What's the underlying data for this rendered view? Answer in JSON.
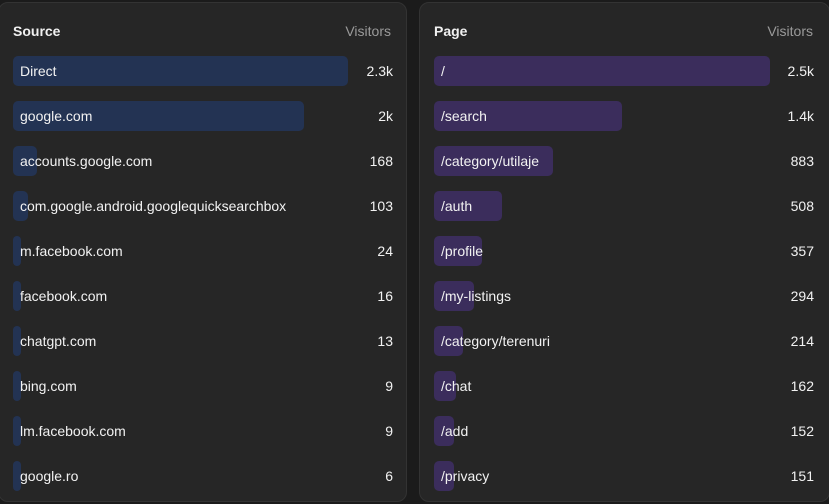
{
  "sources": {
    "title": "Source",
    "metric": "Visitors",
    "bar_color": "#233353",
    "rows": [
      {
        "label": "Direct",
        "value": "2.3k",
        "visitors": 2300
      },
      {
        "label": "google.com",
        "value": "2k",
        "visitors": 2000
      },
      {
        "label": "accounts.google.com",
        "value": "168",
        "visitors": 168
      },
      {
        "label": "com.google.android.googlequicksearchbox",
        "value": "103",
        "visitors": 103
      },
      {
        "label": "m.facebook.com",
        "value": "24",
        "visitors": 24
      },
      {
        "label": "facebook.com",
        "value": "16",
        "visitors": 16
      },
      {
        "label": "chatgpt.com",
        "value": "13",
        "visitors": 13
      },
      {
        "label": "bing.com",
        "value": "9",
        "visitors": 9
      },
      {
        "label": "lm.facebook.com",
        "value": "9",
        "visitors": 9
      },
      {
        "label": "google.ro",
        "value": "6",
        "visitors": 6
      }
    ]
  },
  "pages": {
    "title": "Page",
    "metric": "Visitors",
    "bar_color": "#3b2d5c",
    "rows": [
      {
        "label": "/",
        "value": "2.5k",
        "visitors": 2500
      },
      {
        "label": "/search",
        "value": "1.4k",
        "visitors": 1400
      },
      {
        "label": "/category/utilaje",
        "value": "883",
        "visitors": 883
      },
      {
        "label": "/auth",
        "value": "508",
        "visitors": 508
      },
      {
        "label": "/profile",
        "value": "357",
        "visitors": 357
      },
      {
        "label": "/my-listings",
        "value": "294",
        "visitors": 294
      },
      {
        "label": "/category/terenuri",
        "value": "214",
        "visitors": 214
      },
      {
        "label": "/chat",
        "value": "162",
        "visitors": 162
      },
      {
        "label": "/add",
        "value": "152",
        "visitors": 152
      },
      {
        "label": "/privacy",
        "value": "151",
        "visitors": 151
      }
    ]
  }
}
